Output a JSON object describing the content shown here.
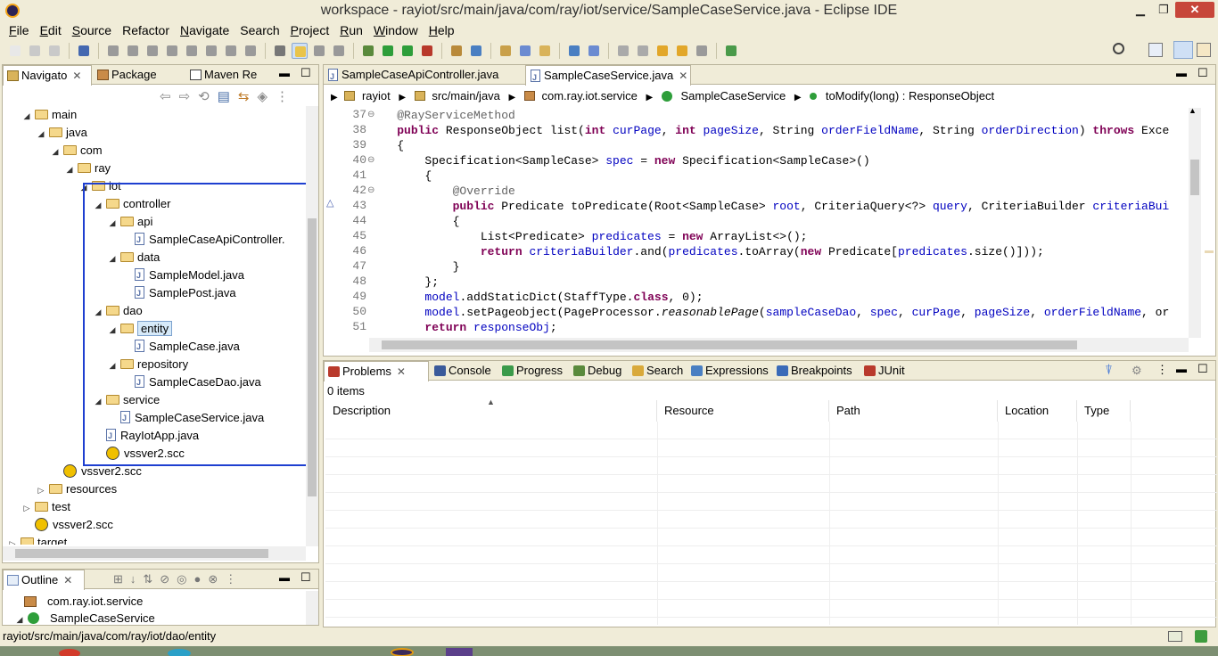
{
  "window": {
    "title": "workspace - rayiot/src/main/java/com/ray/iot/service/SampleCaseService.java - Eclipse IDE",
    "minimize": "▁",
    "restore": "❐",
    "close": "✕"
  },
  "menu": [
    {
      "label": "File",
      "mn": "F",
      "rest": "ile"
    },
    {
      "label": "Edit",
      "mn": "E",
      "rest": "dit"
    },
    {
      "label": "Source",
      "mn": "S",
      "rest": "ource"
    },
    {
      "label": "Refactor",
      "mn": "",
      "rest": "Refactor"
    },
    {
      "label": "Navigate",
      "mn": "N",
      "rest": "avigate"
    },
    {
      "label": "Search",
      "mn": "",
      "rest": "Search"
    },
    {
      "label": "Project",
      "mn": "P",
      "rest": "roject"
    },
    {
      "label": "Run",
      "mn": "R",
      "rest": "un"
    },
    {
      "label": "Window",
      "mn": "W",
      "rest": "indow"
    },
    {
      "label": "Help",
      "mn": "H",
      "rest": "elp"
    }
  ],
  "left_panel": {
    "tabs": [
      "Navigato",
      "Package",
      "Maven Re"
    ],
    "tree": [
      {
        "depth": 2,
        "type": "folder",
        "label": "main",
        "open": true
      },
      {
        "depth": 3,
        "type": "folder",
        "label": "java",
        "open": true
      },
      {
        "depth": 4,
        "type": "folder",
        "label": "com",
        "open": true
      },
      {
        "depth": 5,
        "type": "folder",
        "label": "ray",
        "open": true
      },
      {
        "depth": 6,
        "type": "folder",
        "label": "iot",
        "open": true
      },
      {
        "depth": 7,
        "type": "folder",
        "label": "controller",
        "open": true
      },
      {
        "depth": 8,
        "type": "folder",
        "label": "api",
        "open": true
      },
      {
        "depth": 9,
        "type": "java",
        "label": "SampleCaseApiController."
      },
      {
        "depth": 8,
        "type": "folder",
        "label": "data",
        "open": true
      },
      {
        "depth": 9,
        "type": "java",
        "label": "SampleModel.java"
      },
      {
        "depth": 9,
        "type": "java",
        "label": "SamplePost.java"
      },
      {
        "depth": 7,
        "type": "folder",
        "label": "dao",
        "open": true
      },
      {
        "depth": 8,
        "type": "folder",
        "label": "entity",
        "open": true,
        "selected": true
      },
      {
        "depth": 9,
        "type": "java",
        "label": "SampleCase.java"
      },
      {
        "depth": 8,
        "type": "folder",
        "label": "repository",
        "open": true
      },
      {
        "depth": 9,
        "type": "java",
        "label": "SampleCaseDao.java"
      },
      {
        "depth": 7,
        "type": "folder",
        "label": "service",
        "open": true
      },
      {
        "depth": 8,
        "type": "java",
        "label": "SampleCaseService.java"
      },
      {
        "depth": 7,
        "type": "java",
        "label": "RayIotApp.java"
      },
      {
        "depth": 7,
        "type": "scc",
        "label": "vssver2.scc"
      },
      {
        "depth": 4,
        "type": "scc",
        "label": "vssver2.scc"
      },
      {
        "depth": 3,
        "type": "folder",
        "label": "resources",
        "open": false
      },
      {
        "depth": 2,
        "type": "folder",
        "label": "test",
        "open": false
      },
      {
        "depth": 2,
        "type": "scc",
        "label": "vssver2.scc"
      },
      {
        "depth": 1,
        "type": "folder",
        "label": "target",
        "open": false
      }
    ]
  },
  "outline": {
    "tab": "Outline",
    "items": [
      "com.ray.iot.service",
      "SampleCaseService"
    ]
  },
  "editor": {
    "tabs": [
      "SampleCaseApiController.java",
      "SampleCaseService.java"
    ],
    "breadcrumb": [
      "rayiot",
      "src/main/java",
      "com.ray.iot.service",
      "SampleCaseService",
      "toModify(long) : ResponseObject"
    ],
    "line_numbers": [
      "37",
      "38",
      "39",
      "40",
      "41",
      "42",
      "43",
      "44",
      "45",
      "46",
      "47",
      "48",
      "49",
      "50",
      "51"
    ],
    "lines": [
      [
        {
          "t": "    "
        },
        {
          "t": "@RayServiceMethod",
          "c": "an"
        }
      ],
      [
        {
          "t": "    "
        },
        {
          "t": "public",
          "c": "kw"
        },
        {
          "t": " ResponseObject list("
        },
        {
          "t": "int",
          "c": "kw"
        },
        {
          "t": " "
        },
        {
          "t": "curPage",
          "c": "fld"
        },
        {
          "t": ", "
        },
        {
          "t": "int",
          "c": "kw"
        },
        {
          "t": " "
        },
        {
          "t": "pageSize",
          "c": "fld"
        },
        {
          "t": ", String "
        },
        {
          "t": "orderFieldName",
          "c": "fld"
        },
        {
          "t": ", String "
        },
        {
          "t": "orderDirection",
          "c": "fld"
        },
        {
          "t": ") "
        },
        {
          "t": "throws",
          "c": "kw"
        },
        {
          "t": " Exce"
        }
      ],
      [
        {
          "t": "    {"
        }
      ],
      [
        {
          "t": "        Specification<SampleCase> "
        },
        {
          "t": "spec",
          "c": "fld"
        },
        {
          "t": " = "
        },
        {
          "t": "new",
          "c": "kw"
        },
        {
          "t": " Specification<SampleCase>()"
        }
      ],
      [
        {
          "t": "        {"
        }
      ],
      [
        {
          "t": "            "
        },
        {
          "t": "@Override",
          "c": "an"
        }
      ],
      [
        {
          "t": "            "
        },
        {
          "t": "public",
          "c": "kw"
        },
        {
          "t": " Predicate toPredicate(Root<SampleCase> "
        },
        {
          "t": "root",
          "c": "fld"
        },
        {
          "t": ", CriteriaQuery<?> "
        },
        {
          "t": "query",
          "c": "fld"
        },
        {
          "t": ", CriteriaBuilder "
        },
        {
          "t": "criteriaBui",
          "c": "fld"
        }
      ],
      [
        {
          "t": "            {"
        }
      ],
      [
        {
          "t": "                List<Predicate> "
        },
        {
          "t": "predicates",
          "c": "fld"
        },
        {
          "t": " = "
        },
        {
          "t": "new",
          "c": "kw"
        },
        {
          "t": " ArrayList<>();"
        }
      ],
      [
        {
          "t": "                "
        },
        {
          "t": "return",
          "c": "kw"
        },
        {
          "t": " "
        },
        {
          "t": "criteriaBuilder",
          "c": "fld"
        },
        {
          "t": ".and("
        },
        {
          "t": "predicates",
          "c": "fld"
        },
        {
          "t": ".toArray("
        },
        {
          "t": "new",
          "c": "kw"
        },
        {
          "t": " Predicate["
        },
        {
          "t": "predicates",
          "c": "fld"
        },
        {
          "t": ".size()]));"
        }
      ],
      [
        {
          "t": "            }"
        }
      ],
      [
        {
          "t": "        };"
        }
      ],
      [
        {
          "t": "        "
        },
        {
          "t": "model",
          "c": "fld"
        },
        {
          "t": ".addStaticDict(StaffType."
        },
        {
          "t": "class",
          "c": "kw"
        },
        {
          "t": ", 0);"
        }
      ],
      [
        {
          "t": "        "
        },
        {
          "t": "model",
          "c": "fld"
        },
        {
          "t": ".setPageobject(PageProcessor."
        },
        {
          "t": "reasonablePage",
          "c": "it"
        },
        {
          "t": "("
        },
        {
          "t": "sampleCaseDao",
          "c": "fld"
        },
        {
          "t": ", "
        },
        {
          "t": "spec",
          "c": "fld"
        },
        {
          "t": ", "
        },
        {
          "t": "curPage",
          "c": "fld"
        },
        {
          "t": ", "
        },
        {
          "t": "pageSize",
          "c": "fld"
        },
        {
          "t": ", "
        },
        {
          "t": "orderFieldName",
          "c": "fld"
        },
        {
          "t": ", or"
        }
      ],
      [
        {
          "t": "        "
        },
        {
          "t": "return",
          "c": "kw"
        },
        {
          "t": " "
        },
        {
          "t": "responseObj",
          "c": "fld"
        },
        {
          "t": ";"
        }
      ]
    ]
  },
  "bottom": {
    "tabs": [
      "Problems",
      "Console",
      "Progress",
      "Debug",
      "Search",
      "Expressions",
      "Breakpoints",
      "JUnit"
    ],
    "count": "0 items",
    "columns": [
      "Description",
      "Resource",
      "Path",
      "Location",
      "Type"
    ]
  },
  "status": {
    "text": "rayiot/src/main/java/com/ray/iot/dao/entity"
  }
}
